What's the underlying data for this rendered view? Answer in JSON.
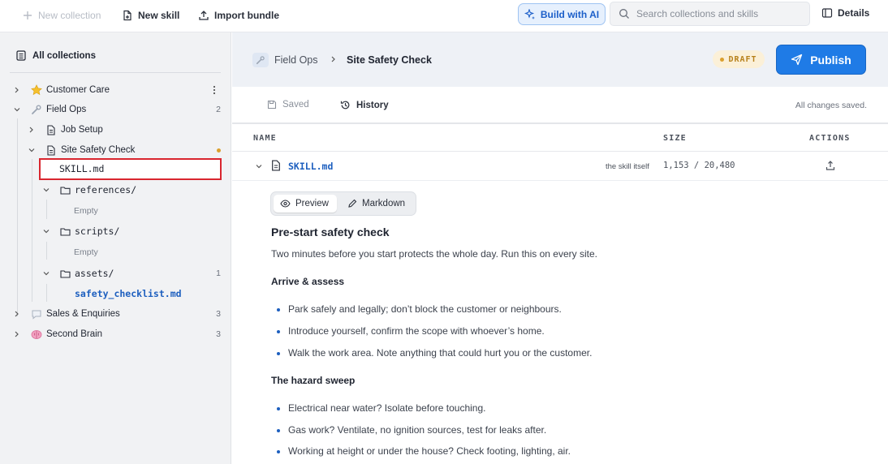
{
  "toolbar": {
    "new_collection": "New collection",
    "new_skill": "New skill",
    "import_bundle": "Import bundle",
    "build_with_ai": "Build with AI",
    "search_placeholder": "Search collections and skills",
    "details": "Details"
  },
  "sidebar": {
    "heading": "All collections",
    "items": [
      {
        "label": "Customer Care",
        "icon": "star-icon"
      },
      {
        "label": "Field Ops",
        "icon": "wrench-icon",
        "count": "2"
      },
      {
        "label": "Job Setup",
        "icon": "document-icon"
      },
      {
        "label": "Site Safety Check",
        "icon": "document-icon",
        "status": "unsaved-dot"
      },
      {
        "label": "SKILL.md"
      },
      {
        "label": "references/",
        "icon": "folder-icon"
      },
      {
        "label": "Empty"
      },
      {
        "label": "scripts/",
        "icon": "folder-icon"
      },
      {
        "label": "Empty"
      },
      {
        "label": "assets/",
        "icon": "folder-icon",
        "count": "1"
      },
      {
        "label": "safety_checklist.md"
      },
      {
        "label": "Sales & Enquiries",
        "icon": "speech-bubble-icon",
        "count": "3"
      },
      {
        "label": "Second Brain",
        "icon": "brain-icon",
        "count": "3"
      }
    ]
  },
  "header": {
    "breadcrumb_parent": "Field Ops",
    "breadcrumb_current": "Site Safety Check",
    "status": "DRAFT",
    "publish": "Publish"
  },
  "subbar": {
    "saved": "Saved",
    "history": "History",
    "status_text": "All changes saved."
  },
  "table": {
    "headers": [
      "NAME",
      "SIZE",
      "ACTIONS"
    ],
    "file": {
      "name": "SKILL.md",
      "note": "the skill itself",
      "size": "1,153 / 20,480"
    }
  },
  "view_toggle": {
    "preview": "Preview",
    "markdown": "Markdown",
    "selected": "Preview"
  },
  "doc": {
    "title": "Pre-start safety check",
    "intro": "Two minutes before you start protects the whole day. Run this on every site.",
    "sections": [
      {
        "heading": "Arrive & assess",
        "items": [
          "Park safely and legally; don’t block the customer or neighbours.",
          "Introduce yourself, confirm the scope with whoever’s home.",
          "Walk the work area. Note anything that could hurt you or the customer."
        ]
      },
      {
        "heading": "The hazard sweep",
        "items": [
          "Electrical near water? Isolate before touching.",
          "Gas work? Ventilate, no ignition sources, test for leaks after.",
          "Working at height or under the house? Check footing, lighting, air."
        ]
      }
    ]
  },
  "colors": {
    "accent": "#1f7be6",
    "link": "#1d5fbf",
    "draft": "#b7811b",
    "selection_outline": "#d9262f"
  }
}
